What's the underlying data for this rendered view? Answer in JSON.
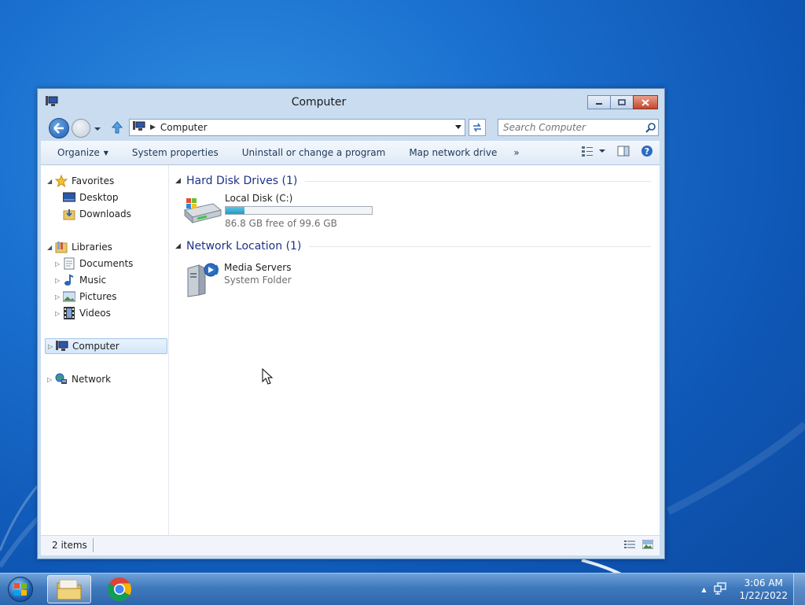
{
  "window": {
    "title": "Computer",
    "caption_buttons": [
      "minimize",
      "maximize",
      "close"
    ]
  },
  "navbar": {
    "address_path": "Computer",
    "search_placeholder": "Search Computer"
  },
  "toolbar": {
    "organize_label": "Organize",
    "items": [
      "System properties",
      "Uninstall or change a program",
      "Map network drive"
    ],
    "more_label": "»"
  },
  "navpane": {
    "favorites": {
      "label": "Favorites",
      "items": [
        "Desktop",
        "Downloads"
      ]
    },
    "libraries": {
      "label": "Libraries",
      "items": [
        "Documents",
        "Music",
        "Pictures",
        "Videos"
      ]
    },
    "computer_label": "Computer",
    "network_label": "Network"
  },
  "groups": {
    "hard_disk": {
      "header": "Hard Disk Drives (1)",
      "drive_name": "Local Disk (C:)",
      "drive_free_text": "86.8 GB free of 99.6 GB",
      "used_fraction": 0.13
    },
    "network_location": {
      "header": "Network Location (1)",
      "item_name": "Media Servers",
      "item_sub": "System Folder"
    }
  },
  "statusbar": {
    "count_text": "2 items"
  },
  "taskbar": {
    "apps": [
      "windows-explorer",
      "google-chrome"
    ],
    "clock_time": "3:06 AM",
    "clock_date": "1/22/2022"
  },
  "colors": {
    "desktop_blue": "#1a6fcf",
    "group_header": "#1e3287",
    "capacity_fill": "#1f9bc7",
    "close_red": "#c7462e"
  }
}
